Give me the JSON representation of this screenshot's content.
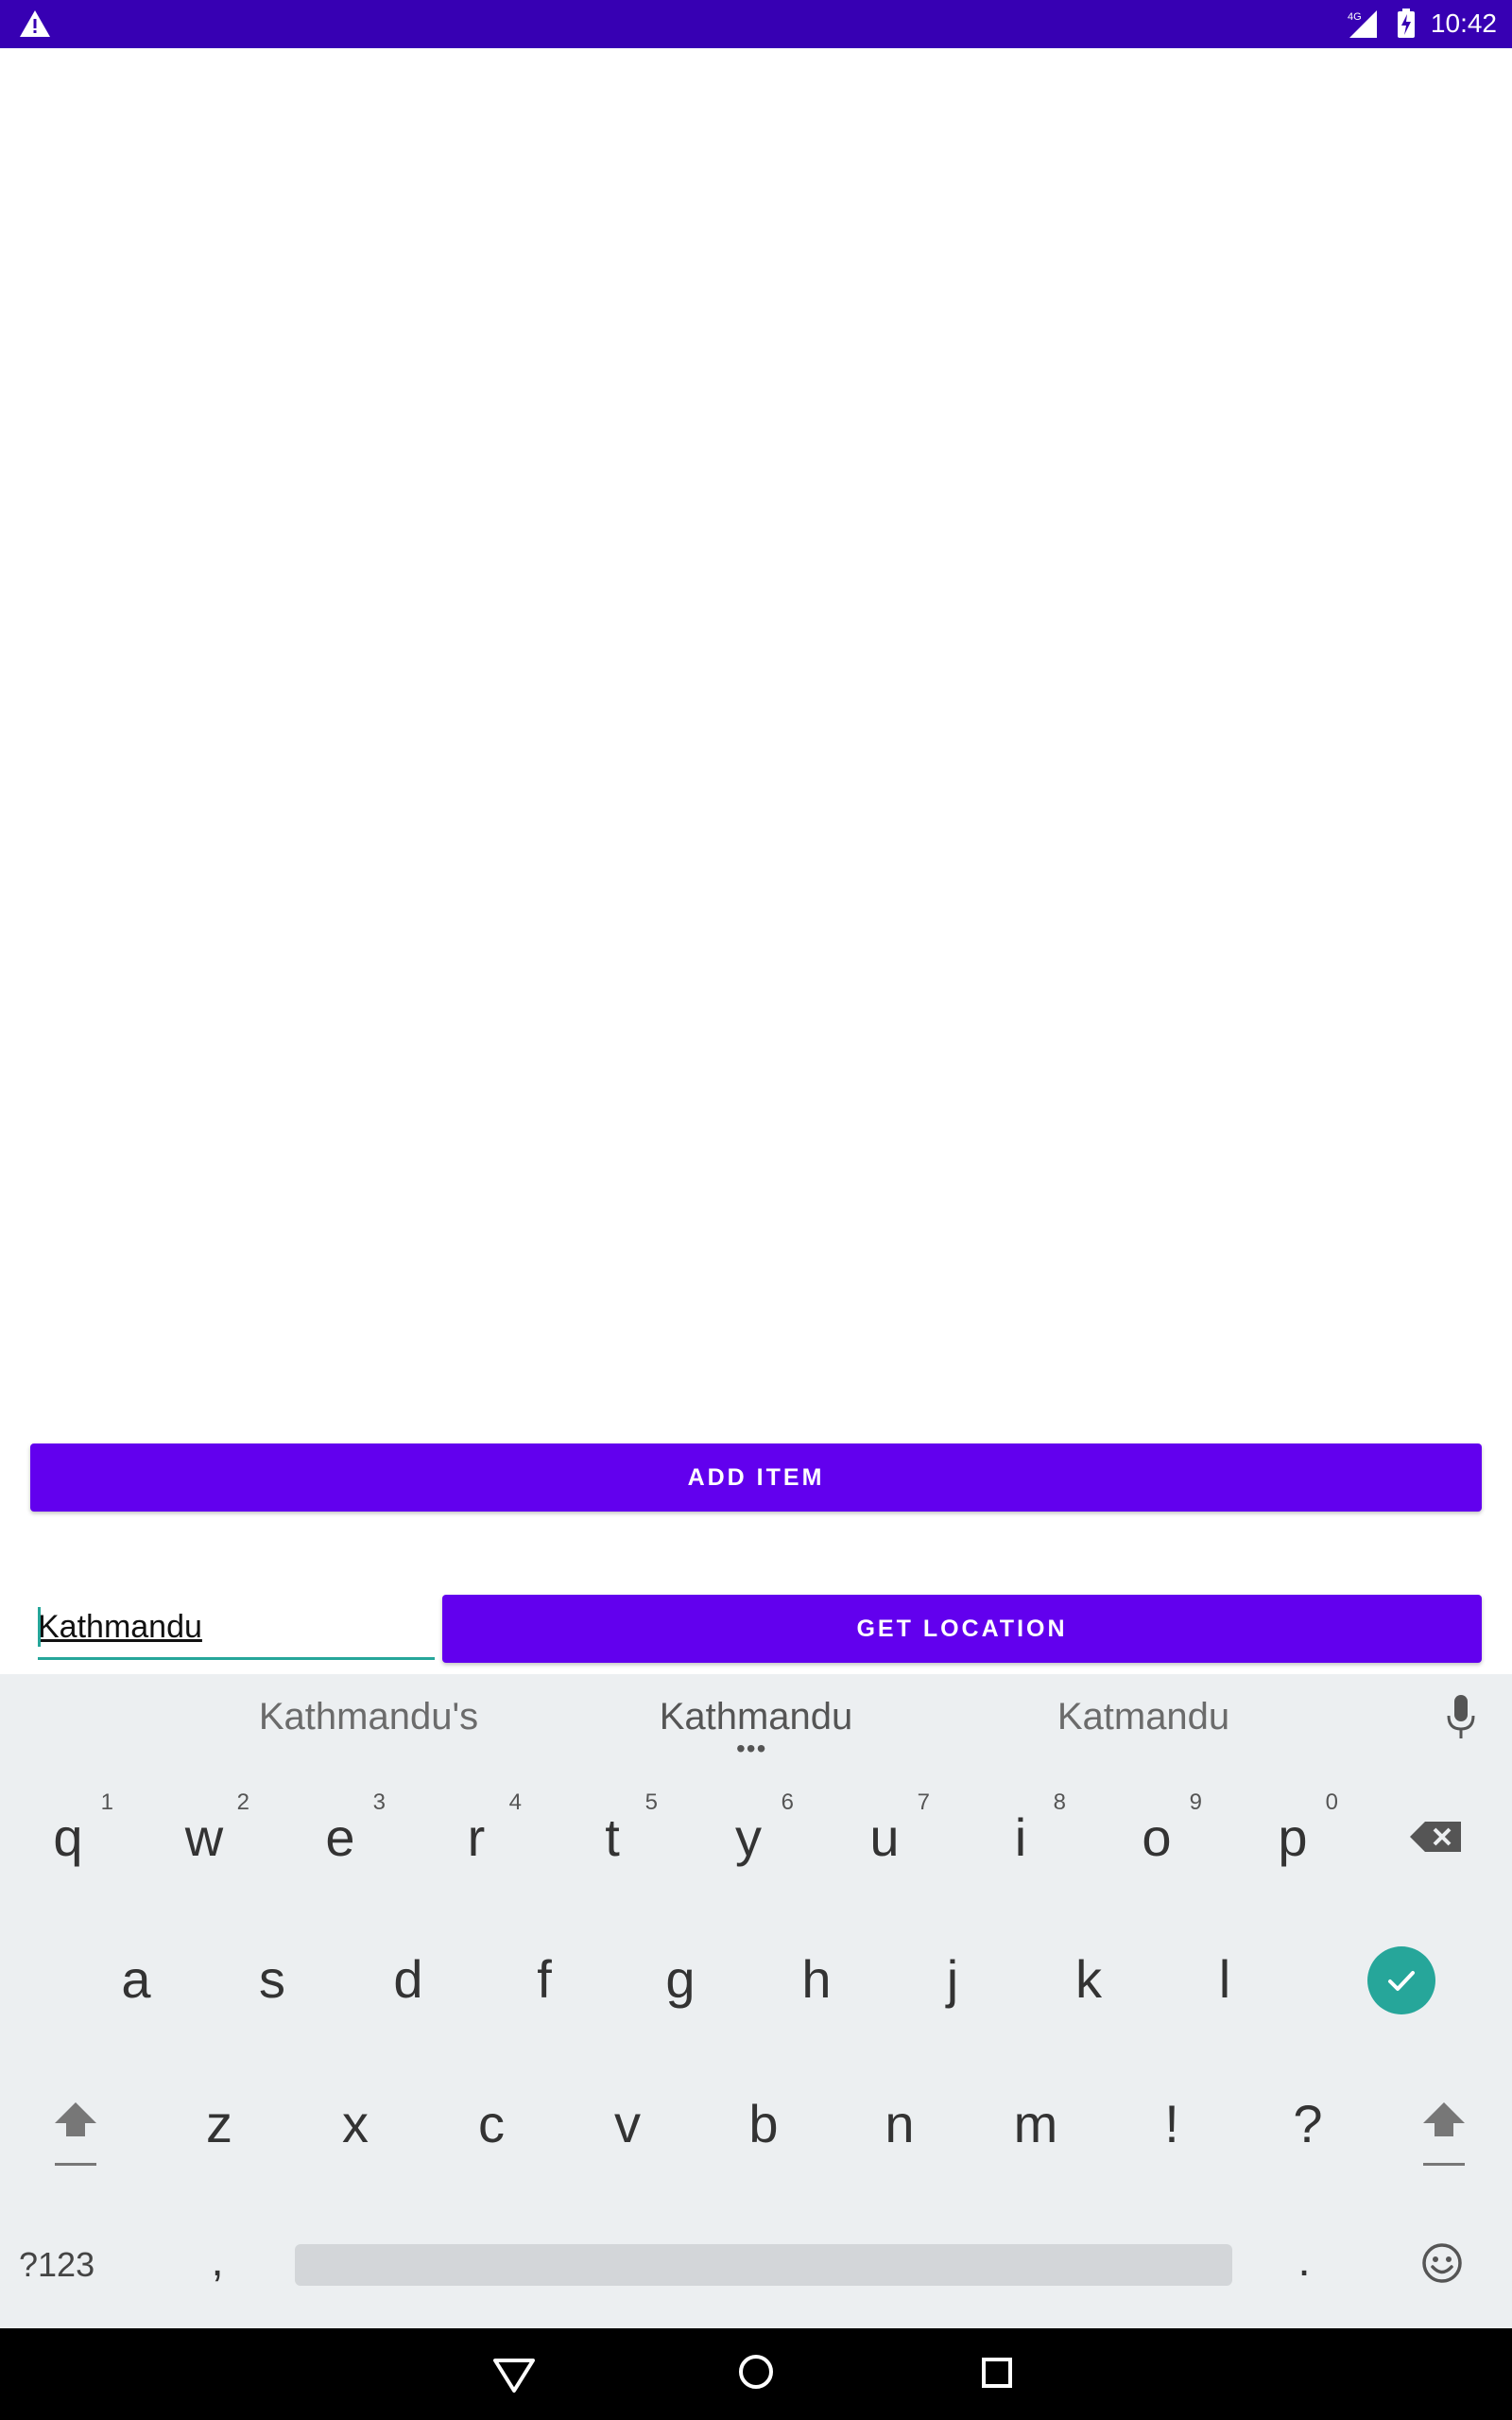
{
  "status_bar": {
    "time": "10:42",
    "network": "4G",
    "icons": [
      "warning-icon",
      "signal-icon",
      "battery-icon"
    ],
    "color": "#3700b3"
  },
  "main": {
    "add_item_label": "ADD ITEM",
    "location_input_value": "Kathmandu",
    "get_location_label": "GET LOCATION",
    "accent_color": "#6200ee"
  },
  "keyboard": {
    "suggestions": [
      "Kathmandu's",
      "Kathmandu",
      "Katmandu"
    ],
    "row1": [
      {
        "key": "q",
        "hint": "1"
      },
      {
        "key": "w",
        "hint": "2"
      },
      {
        "key": "e",
        "hint": "3"
      },
      {
        "key": "r",
        "hint": "4"
      },
      {
        "key": "t",
        "hint": "5"
      },
      {
        "key": "y",
        "hint": "6"
      },
      {
        "key": "u",
        "hint": "7"
      },
      {
        "key": "i",
        "hint": "8"
      },
      {
        "key": "o",
        "hint": "9"
      },
      {
        "key": "p",
        "hint": "0"
      }
    ],
    "row2": [
      "a",
      "s",
      "d",
      "f",
      "g",
      "h",
      "j",
      "k",
      "l"
    ],
    "row3": [
      "z",
      "x",
      "c",
      "v",
      "b",
      "n",
      "m",
      "!",
      "?"
    ],
    "symbols_label": "?123",
    "comma": ",",
    "period": ".",
    "enter_color": "#26a69a"
  }
}
